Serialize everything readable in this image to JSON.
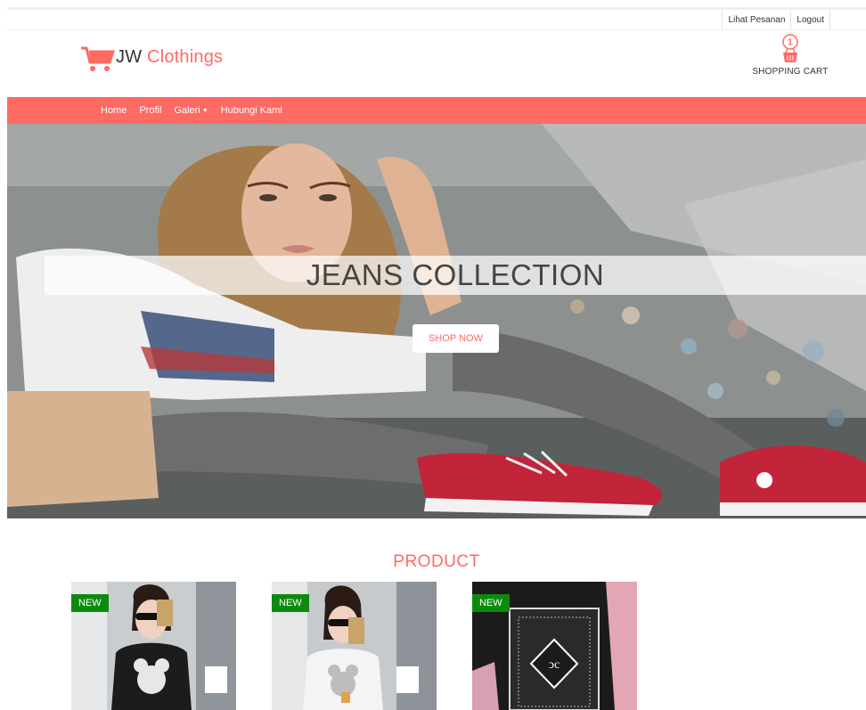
{
  "topbar": {
    "links": [
      "Lihat Pesanan",
      "Logout"
    ]
  },
  "header": {
    "logo_prefix": "JW",
    "logo_accent": "Clothings",
    "cart_count": "1",
    "cart_label": "SHOPPING CART"
  },
  "nav": {
    "items": [
      "Home",
      "Profil",
      "Galeri",
      "Hubungi Kami"
    ]
  },
  "hero": {
    "title": "JEANS COLLECTION",
    "button_label": "SHOP NOW"
  },
  "products": {
    "title": "PRODUCT",
    "items": [
      {
        "badge": "NEW"
      },
      {
        "badge": "NEW"
      },
      {
        "badge": "NEW"
      }
    ]
  },
  "colors": {
    "accent": "#ff6a63",
    "badge": "#0d8a0d"
  },
  "icons": {
    "logo": "shopping-cart-icon",
    "cart": "shopping-basket-icon",
    "dropdown": "caret-down-icon"
  }
}
